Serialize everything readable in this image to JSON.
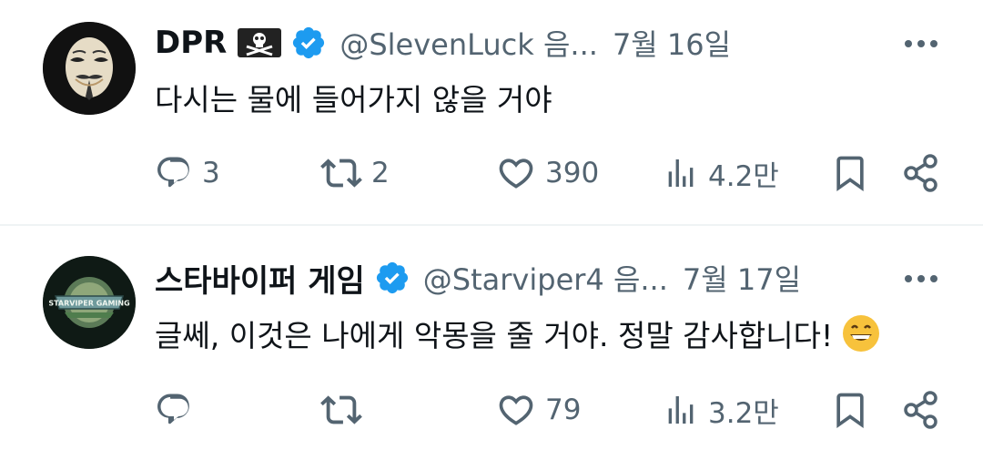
{
  "tweets": [
    {
      "author": {
        "name": "DPR",
        "handle": "@SlevenLuck 음...",
        "avatar": "guy-fawkes-mask-avatar",
        "badge": "pirate-flag-icon",
        "verified": true
      },
      "time": "7월 16일",
      "text": "다시는 물에 들어가지 않을 거야",
      "actions": {
        "replies": "3",
        "retweets": "2",
        "likes": "390",
        "views": "4.2만"
      }
    },
    {
      "author": {
        "name": "스타바이퍼 게임",
        "handle": "@Starviper4 음...",
        "avatar": "starviper-gaming-logo-avatar",
        "verified": true
      },
      "time": "7월 17일",
      "text": "글쎄, 이것은 나에게 악몽을 줄 거야. 정말 감사합니다!",
      "emoji": "grinning-face-emoji",
      "actions": {
        "replies": "",
        "retweets": "",
        "likes": "79",
        "views": "3.2만"
      }
    }
  ],
  "avatar_logo_text": "STARVIPER GAMING",
  "colors": {
    "text": "#0f1419",
    "secondary": "#536471",
    "verified": "#1d9bf0",
    "divider": "#eff3f4"
  }
}
